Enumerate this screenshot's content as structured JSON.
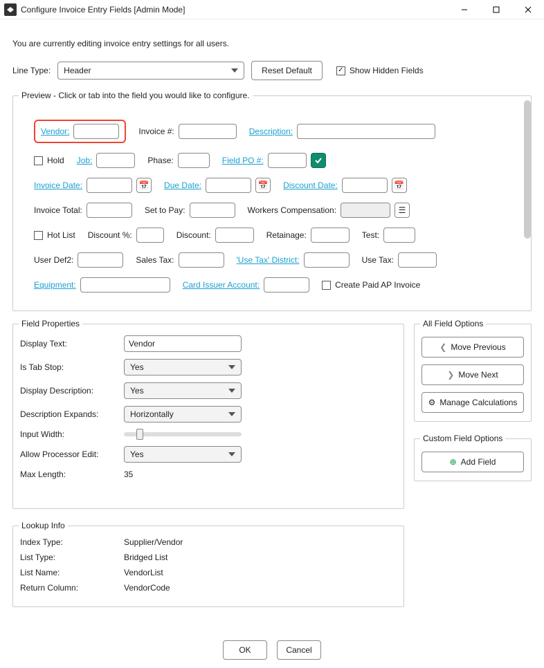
{
  "window": {
    "title": "Configure Invoice Entry Fields [Admin Mode]"
  },
  "intro": "You are currently editing invoice entry settings for all users.",
  "lineType": {
    "label": "Line Type:",
    "value": "Header"
  },
  "resetBtn": "Reset Default",
  "showHidden": {
    "label": "Show Hidden Fields",
    "checked": true
  },
  "preview": {
    "legend": "Preview - Click or tab into the field you would like to configure.",
    "fields": {
      "vendor": "Vendor:",
      "invoiceNum": "Invoice #:",
      "description": "Description:",
      "hold": "Hold",
      "job": "Job:",
      "phase": "Phase:",
      "fieldPO": "Field PO #:",
      "invoiceDate": "Invoice Date:",
      "dueDate": "Due Date:",
      "discountDate": "Discount Date:",
      "invoiceTotal": "Invoice Total:",
      "setToPay": "Set to Pay:",
      "workersComp": "Workers Compensation:",
      "hotList": "Hot List",
      "discountPct": "Discount %:",
      "discount": "Discount:",
      "retainage": "Retainage:",
      "test": "Test:",
      "userDef2": "User Def2:",
      "salesTax": "Sales Tax:",
      "useTaxDistrict": "'Use Tax' District:",
      "useTax": "Use Tax:",
      "equipment": "Equipment:",
      "cardIssuer": "Card Issuer Account:",
      "createPaidAP": "Create Paid AP Invoice"
    }
  },
  "fieldProps": {
    "legend": "Field Properties",
    "displayText": {
      "label": "Display Text:",
      "value": "Vendor"
    },
    "isTabStop": {
      "label": "Is Tab Stop:",
      "value": "Yes"
    },
    "displayDesc": {
      "label": "Display Description:",
      "value": "Yes"
    },
    "descExpands": {
      "label": "Description Expands:",
      "value": "Horizontally"
    },
    "inputWidth": {
      "label": "Input Width:"
    },
    "allowProcEdit": {
      "label": "Allow Processor Edit:",
      "value": "Yes"
    },
    "maxLength": {
      "label": "Max Length:",
      "value": "35"
    }
  },
  "allFieldOpts": {
    "legend": "All Field Options",
    "movePrev": "Move Previous",
    "moveNext": "Move Next",
    "manageCalc": "Manage Calculations"
  },
  "customOpts": {
    "legend": "Custom Field Options",
    "addField": "Add Field"
  },
  "lookup": {
    "legend": "Lookup Info",
    "indexType": {
      "label": "Index Type:",
      "value": "Supplier/Vendor"
    },
    "listType": {
      "label": "List Type:",
      "value": "Bridged List"
    },
    "listName": {
      "label": "List Name:",
      "value": "VendorList"
    },
    "returnCol": {
      "label": "Return Column:",
      "value": "VendorCode"
    }
  },
  "footer": {
    "ok": "OK",
    "cancel": "Cancel"
  }
}
